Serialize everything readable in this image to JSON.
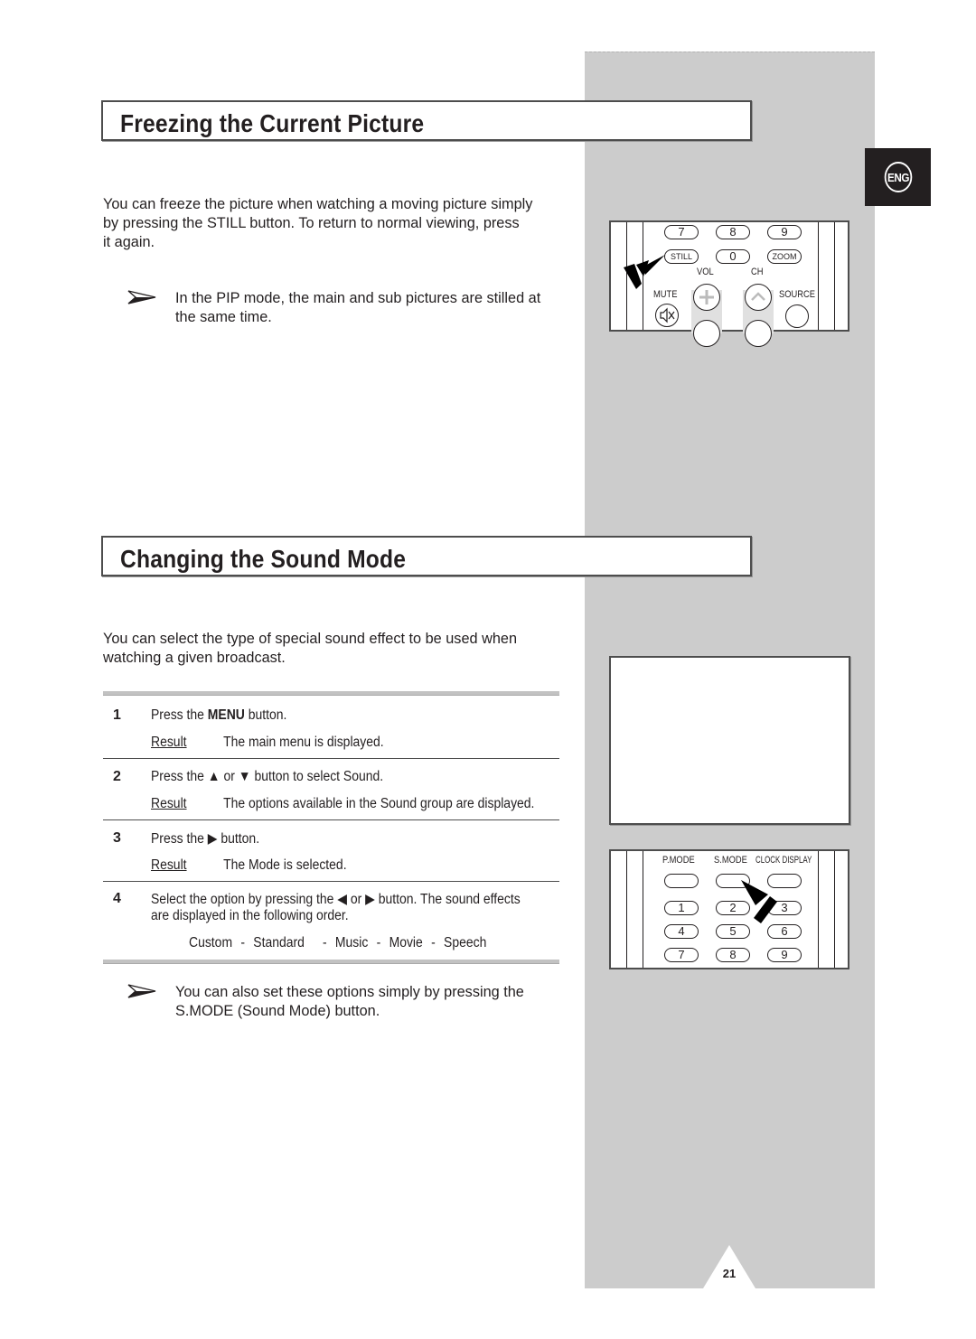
{
  "language_badge": "ENG",
  "page_number": "21",
  "sections": {
    "freeze": {
      "title": "Freezing the Current Picture",
      "body_lines": [
        "You can freeze the picture when watching a moving picture simply",
        "by pressing the  STILL  button. To return to normal viewing, press",
        "it again."
      ],
      "note_lines": [
        "In the PIP mode, the main and sub pictures are stilled at",
        "the same time."
      ]
    },
    "sound": {
      "title": "Changing the Sound Mode",
      "body_lines": [
        "You can select the type of special sound effect to be used when",
        "watching a given broadcast."
      ],
      "steps": [
        {
          "num": "1",
          "instr_pre": "Press the ",
          "instr_bold": "MENU",
          "instr_post": " button.",
          "result_label": "Result",
          "result_text": "The main menu is displayed."
        },
        {
          "num": "2",
          "instr": "Press the ▲ or ▼ button to select Sound.",
          "result_label": "Result",
          "result_text": "The options available in the Sound  group are displayed."
        },
        {
          "num": "3",
          "instr": "Press the ▶ button.",
          "result_label": "Result",
          "result_text": "The  Mode is selected."
        },
        {
          "num": "4",
          "instr_line1": "Select the option by pressing the ◀ or ▶ button. The sound effects",
          "instr_line2": "are displayed in the following order.",
          "order": [
            "Custom",
            "-",
            "Standard",
            "-",
            "Music",
            "-",
            "Movie",
            "-",
            "Speech"
          ]
        }
      ],
      "note_lines": [
        "You can also set these options simply by pressing the",
        "S.MODE (Sound Mode) button."
      ]
    }
  },
  "remote_1": {
    "row1": [
      "7",
      "8",
      "9"
    ],
    "row2": [
      "STILL",
      "0",
      "ZOOM"
    ],
    "vol_label": "VOL",
    "ch_label": "CH",
    "mute_label": "MUTE",
    "source_label": "SOURCE",
    "icons": [
      "mute-icon",
      "plus-icon",
      "chevron-up-icon"
    ]
  },
  "remote_2": {
    "labels": [
      "P.MODE",
      "S.MODE",
      "CLOCK DISPLAY"
    ],
    "row1": [
      "1",
      "2",
      "3"
    ],
    "row2": [
      "4",
      "5",
      "6"
    ],
    "row3": [
      "7",
      "8",
      "9"
    ]
  }
}
